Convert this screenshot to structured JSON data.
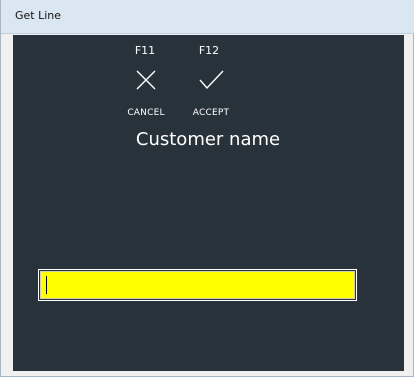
{
  "window": {
    "title": "Get Line"
  },
  "actions": [
    {
      "key": "F11",
      "label": "CANCEL",
      "icon": "close-icon"
    },
    {
      "key": "F12",
      "label": "ACCEPT",
      "icon": "checkmark-icon"
    }
  ],
  "prompt": {
    "heading": "Customer name"
  },
  "input": {
    "value": "",
    "background_color": "#ffff00"
  },
  "colors": {
    "client_background": "#27323b",
    "titlebar_background": "#dbe6f3",
    "text": "#ffffff"
  }
}
